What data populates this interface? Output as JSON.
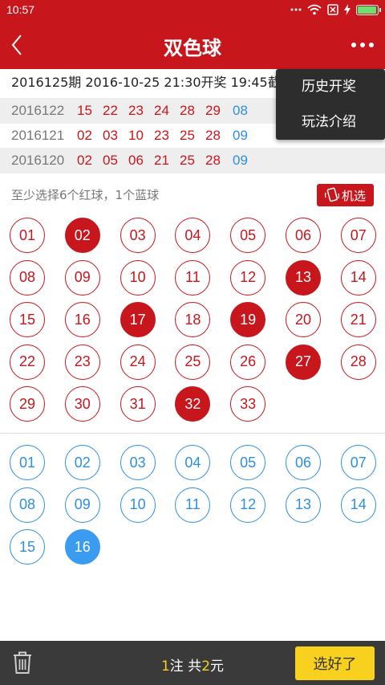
{
  "status_bar": {
    "time": "10:57"
  },
  "nav": {
    "title": "双色球"
  },
  "current_issue": {
    "text": "2016125期 2016-10-25 21:30开奖 19:45截止"
  },
  "history": [
    {
      "issue": "2016122",
      "red": [
        "15",
        "22",
        "23",
        "24",
        "28",
        "29"
      ],
      "blue": "08"
    },
    {
      "issue": "2016121",
      "red": [
        "02",
        "03",
        "10",
        "23",
        "25",
        "28"
      ],
      "blue": "09"
    },
    {
      "issue": "2016120",
      "red": [
        "02",
        "05",
        "06",
        "21",
        "25",
        "28"
      ],
      "blue": "09"
    }
  ],
  "popup_menu": {
    "items": [
      "历史开奖",
      "玩法介绍"
    ]
  },
  "hint": "至少选择6个红球，1个蓝球",
  "random_button": {
    "label": "机选"
  },
  "red_balls": [
    {
      "n": "01",
      "sel": false
    },
    {
      "n": "02",
      "sel": true
    },
    {
      "n": "03",
      "sel": false
    },
    {
      "n": "04",
      "sel": false
    },
    {
      "n": "05",
      "sel": false
    },
    {
      "n": "06",
      "sel": false
    },
    {
      "n": "07",
      "sel": false
    },
    {
      "n": "08",
      "sel": false
    },
    {
      "n": "09",
      "sel": false
    },
    {
      "n": "10",
      "sel": false
    },
    {
      "n": "11",
      "sel": false
    },
    {
      "n": "12",
      "sel": false
    },
    {
      "n": "13",
      "sel": true
    },
    {
      "n": "14",
      "sel": false
    },
    {
      "n": "15",
      "sel": false
    },
    {
      "n": "16",
      "sel": false
    },
    {
      "n": "17",
      "sel": true
    },
    {
      "n": "18",
      "sel": false
    },
    {
      "n": "19",
      "sel": true
    },
    {
      "n": "20",
      "sel": false
    },
    {
      "n": "21",
      "sel": false
    },
    {
      "n": "22",
      "sel": false
    },
    {
      "n": "23",
      "sel": false
    },
    {
      "n": "24",
      "sel": false
    },
    {
      "n": "25",
      "sel": false
    },
    {
      "n": "26",
      "sel": false
    },
    {
      "n": "27",
      "sel": true
    },
    {
      "n": "28",
      "sel": false
    },
    {
      "n": "29",
      "sel": false
    },
    {
      "n": "30",
      "sel": false
    },
    {
      "n": "31",
      "sel": false
    },
    {
      "n": "32",
      "sel": true
    },
    {
      "n": "33",
      "sel": false
    }
  ],
  "blue_balls": [
    {
      "n": "01",
      "sel": false
    },
    {
      "n": "02",
      "sel": false
    },
    {
      "n": "03",
      "sel": false
    },
    {
      "n": "04",
      "sel": false
    },
    {
      "n": "05",
      "sel": false
    },
    {
      "n": "06",
      "sel": false
    },
    {
      "n": "07",
      "sel": false
    },
    {
      "n": "08",
      "sel": false
    },
    {
      "n": "09",
      "sel": false
    },
    {
      "n": "10",
      "sel": false
    },
    {
      "n": "11",
      "sel": false
    },
    {
      "n": "12",
      "sel": false
    },
    {
      "n": "13",
      "sel": false
    },
    {
      "n": "14",
      "sel": false
    },
    {
      "n": "15",
      "sel": false
    },
    {
      "n": "16",
      "sel": true
    }
  ],
  "bottom_bar": {
    "bets": "1",
    "bets_unit": "注 共",
    "amount": "2",
    "amount_unit": "元",
    "confirm_label": "选好了"
  },
  "colors": {
    "brand_red": "#c8161d",
    "blue": "#2e8fe0",
    "confirm_yellow": "#f7d11e"
  }
}
